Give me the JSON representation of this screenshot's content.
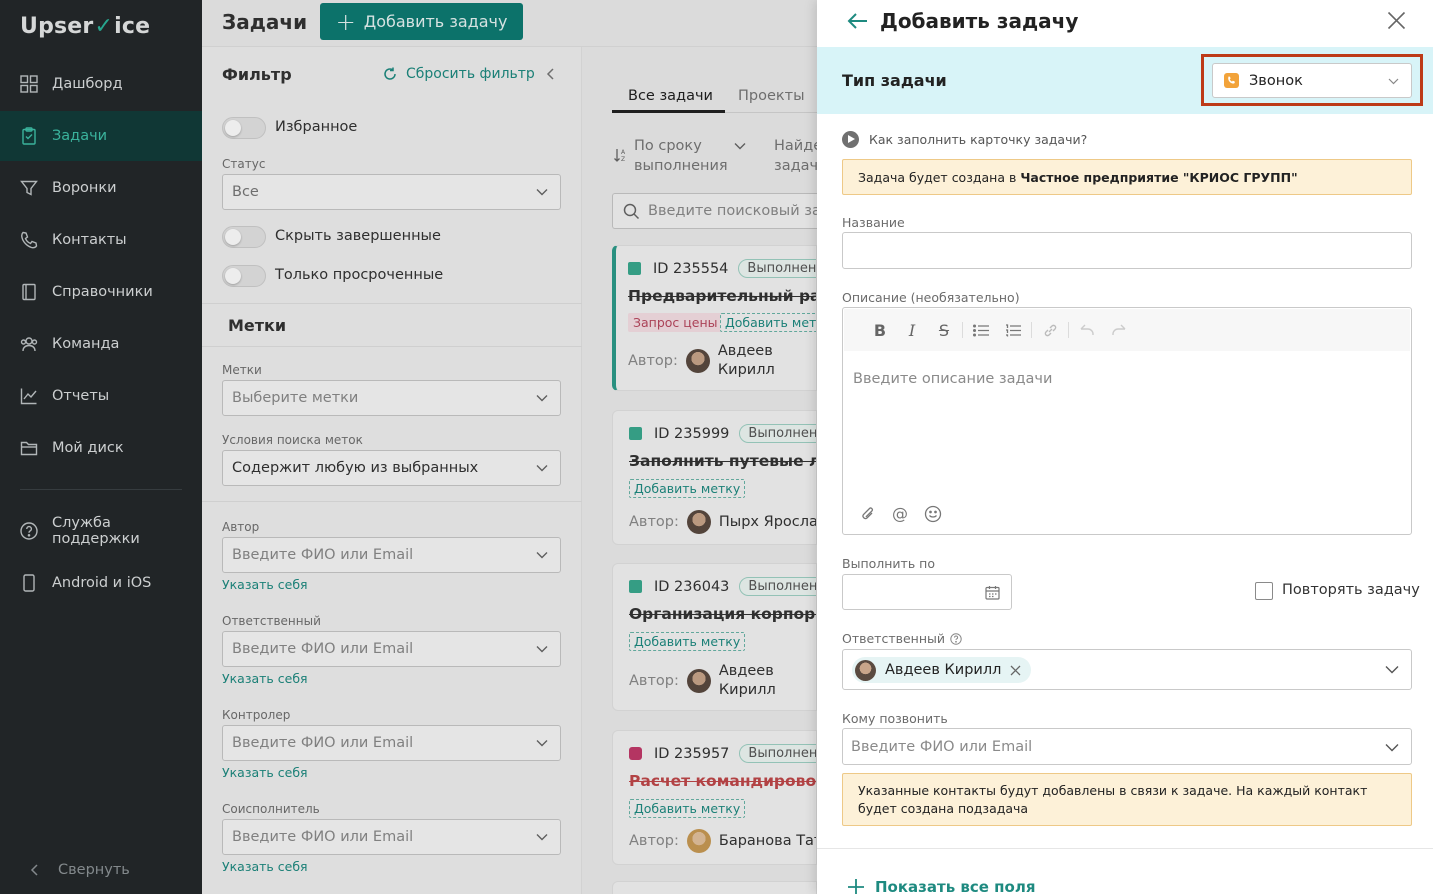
{
  "sidebar": {
    "logo_left": "Upser",
    "logo_v": "V",
    "logo_right": "ice",
    "items": [
      {
        "label": "Дашборд",
        "icon": "dashboard-icon"
      },
      {
        "label": "Задачи",
        "icon": "tasks-icon",
        "active": true
      },
      {
        "label": "Воронки",
        "icon": "funnel-icon"
      },
      {
        "label": "Контакты",
        "icon": "phone-icon"
      },
      {
        "label": "Справочники",
        "icon": "book-icon"
      },
      {
        "label": "Команда",
        "icon": "team-icon"
      },
      {
        "label": "Отчеты",
        "icon": "chart-icon"
      },
      {
        "label": "Мой диск",
        "icon": "folder-icon"
      }
    ],
    "support_label": "Служба поддержки",
    "mobile_label": "Android и iOS",
    "collapse_label": "Свернуть"
  },
  "header": {
    "title": "Задачи",
    "add_button": "Добавить задачу"
  },
  "filter": {
    "title": "Фильтр",
    "reset": "Сбросить фильтр",
    "favorites": "Избранное",
    "status_label": "Статус",
    "status_value": "Все",
    "hide_completed": "Скрыть завершенные",
    "only_overdue": "Только просроченные",
    "tags_section": "Метки",
    "tags_label": "Метки",
    "tags_placeholder": "Выберите метки",
    "tag_cond_label": "Условия поиска меток",
    "tag_cond_value": "Содержит любую из выбранных",
    "author_label": "Автор",
    "responsible_label": "Ответственный",
    "controller_label": "Контролер",
    "coexecutor_label": "Соисполнитель",
    "person_placeholder": "Введите ФИО или Email",
    "self_link": "Указать себя"
  },
  "tasks": {
    "tab_all": "Все задачи",
    "tab_projects": "Проекты",
    "sort_line1": "По сроку",
    "sort_line2": "выполнения",
    "find_line1": "Найде",
    "find_line2": "задач",
    "search_placeholder": "Введите поисковый запрос",
    "author_prefix": "Автор:",
    "add_tag": "Добавить метку",
    "cards": [
      {
        "id": "ID 235554",
        "status": "Выполнена",
        "title": "Предварительный расчет",
        "tag": "Запрос цены",
        "author1": "Авдеев",
        "author2": "Кирилл"
      },
      {
        "id": "ID 235999",
        "status": "Выполнена",
        "title": "Заполнить путевые листы",
        "author1": "Пырх Ярослав"
      },
      {
        "id": "ID 236043",
        "status": "Выполнена",
        "title": "Организация корпоратива",
        "author1": "Авдеев",
        "author2": "Кирилл"
      },
      {
        "id": "ID 235957",
        "status": "Выполнена",
        "title": "Расчет командировочных",
        "author1": "Баранова Татьяна"
      }
    ]
  },
  "drawer": {
    "title": "Добавить задачу",
    "type_label": "Тип задачи",
    "type_value": "Звонок",
    "how_to": "Как заполнить карточку задачи?",
    "note_prefix": "Задача будет создана в ",
    "note_company": "Частное предприятие \"КРИОС ГРУПП\"",
    "name_label": "Название",
    "name_value": "",
    "desc_label": "Описание (необязательно)",
    "desc_placeholder": "Введите описание задачи",
    "due_label": "Выполнить по",
    "repeat_label": "Повторять задачу",
    "responsible_label": "Ответственный",
    "responsible_value": "Авдеев Кирилл",
    "call_label": "Кому позвонить",
    "call_placeholder": "Введите ФИО или Email",
    "contacts_note": "Указанные контакты будут добавлены в связи к задаче. На каждый контакт будет создана подзадача",
    "show_all": "Показать все поля"
  },
  "colors": {
    "sidebar_bg": "#24282a",
    "accent": "#0d7b73",
    "active_text": "#3fc0a8",
    "type_bar": "#d8f4f8",
    "highlight_border": "#bd3a18",
    "note_bg": "#fdf1d8"
  }
}
